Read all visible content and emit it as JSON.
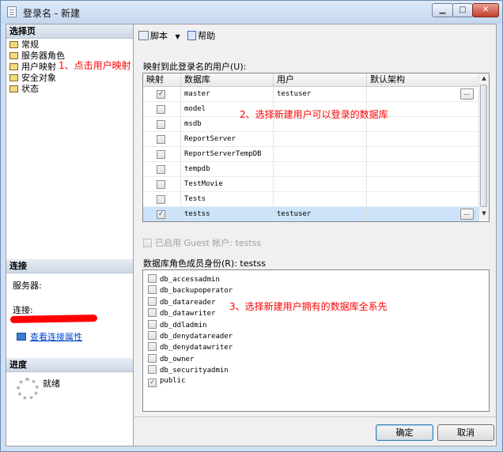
{
  "window": {
    "title": "登录名 - 新建",
    "controls": {
      "min": "▁",
      "max": "□",
      "close": "✕"
    }
  },
  "left": {
    "select_page_header": "选择页",
    "pages": [
      {
        "label": "常规",
        "icon": "page-icon"
      },
      {
        "label": "服务器角色",
        "icon": "page-icon"
      },
      {
        "label": "用户映射",
        "icon": "page-icon"
      },
      {
        "label": "安全对象",
        "icon": "page-icon"
      },
      {
        "label": "状态",
        "icon": "page-icon"
      }
    ],
    "connection_header": "连接",
    "server_label": "服务器:",
    "connection_label": "连接:",
    "view_props_link": "查看连接属性",
    "progress_header": "进度",
    "ready_text": "就绪"
  },
  "toolbar": {
    "script_label": "脚本",
    "dropdown": "▼",
    "help_label": "帮助"
  },
  "mapping": {
    "label": "映射到此登录名的用户(U):",
    "columns": [
      "映射",
      "数据库",
      "用户",
      "默认架构"
    ],
    "rows": [
      {
        "checked": true,
        "database": "master",
        "user": "testuser",
        "has_button": true,
        "selected": false
      },
      {
        "checked": false,
        "database": "model",
        "user": "",
        "has_button": false,
        "selected": false
      },
      {
        "checked": false,
        "database": "msdb",
        "user": "",
        "has_button": false,
        "selected": false
      },
      {
        "checked": false,
        "database": "ReportServer",
        "user": "",
        "has_button": false,
        "selected": false
      },
      {
        "checked": false,
        "database": "ReportServerTempDB",
        "user": "",
        "has_button": false,
        "selected": false
      },
      {
        "checked": false,
        "database": "tempdb",
        "user": "",
        "has_button": false,
        "selected": false
      },
      {
        "checked": false,
        "database": "TestMovie",
        "user": "",
        "has_button": false,
        "selected": false
      },
      {
        "checked": false,
        "database": "Tests",
        "user": "",
        "has_button": false,
        "selected": false
      },
      {
        "checked": true,
        "database": "testss",
        "user": "testuser",
        "has_button": true,
        "selected": true
      }
    ],
    "ellipsis": "...",
    "scroll_up": "▲",
    "scroll_down": "▼"
  },
  "guest": {
    "label": "已启用 Guest 帐户: testss",
    "checked": false
  },
  "roles": {
    "label": "数据库角色成员身份(R): testss",
    "items": [
      {
        "name": "db_accessadmin",
        "checked": false
      },
      {
        "name": "db_backupoperator",
        "checked": false
      },
      {
        "name": "db_datareader",
        "checked": false
      },
      {
        "name": "db_datawriter",
        "checked": false
      },
      {
        "name": "db_ddladmin",
        "checked": false
      },
      {
        "name": "db_denydatareader",
        "checked": false
      },
      {
        "name": "db_denydatawriter",
        "checked": false
      },
      {
        "name": "db_owner",
        "checked": false
      },
      {
        "name": "db_securityadmin",
        "checked": false
      },
      {
        "name": "public",
        "checked": true
      }
    ]
  },
  "buttons": {
    "ok": "确定",
    "cancel": "取消"
  },
  "annotations": {
    "a1": "1、点击用户映射",
    "a2": "2、选择新建用户可以登录的数据库",
    "a3": "3、选择新建用户拥有的数据库全系先",
    "color": "#ff0000"
  }
}
